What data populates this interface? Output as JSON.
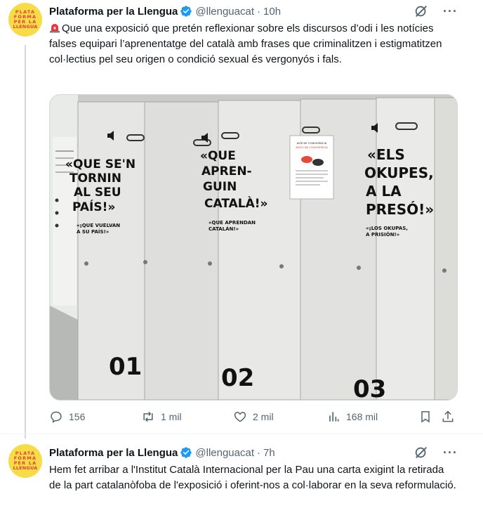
{
  "tweets": [
    {
      "avatar_lines": [
        "PLATA",
        "FORMA",
        "PER LA",
        "LLENGUA"
      ],
      "name": "Plataforma per la Llengua",
      "handle": "@llenguacat",
      "separator": "·",
      "time": "10h",
      "text": "Que una exposició que pretén reflexionar sobre els discursos d’odi i les notícies falses equipari l’aprenentatge del català amb frases que criminalitzen i estigmatitzen col·lectius pel seu origen o condició sexual és vergonyós i fals.",
      "media": {
        "lockers": [
          {
            "quote_lines": [
              "«QUE SE'N",
              "TORNIN",
              "AL SEU",
              "PAÍS!»"
            ],
            "translation_lines": [
              "«¡QUE VUELVAN",
              "A SU PAÍS!»"
            ],
            "number": "01"
          },
          {
            "quote_lines": [
              "«QUE",
              "APREN-",
              "GUIN",
              "CATALÀ!»"
            ],
            "translation_lines": [
              "«QUE APRENDAN",
              "CATALÁN!»"
            ],
            "number": "02"
          },
          {
            "quote_lines": [
              "«ELS",
              "OKUPES,",
              "A LA",
              "PRESÓ!»"
            ],
            "translation_lines": [
              "«¡LOS OKUPAS,",
              "A PRISIÓN!»"
            ],
            "number": "03"
          }
        ],
        "notice": {
          "title_lines": [
            "AVÍS DE CONVIVÈNCIA",
            "AVISO DE CONVIVENCIA"
          ]
        }
      },
      "actions": {
        "replies": "156",
        "reposts": "1 mil",
        "likes": "2 mil",
        "views": "168 mil"
      }
    },
    {
      "avatar_lines": [
        "PLATA",
        "FORMA",
        "PER LA",
        "LLENGUA"
      ],
      "name": "Plataforma per la Llengua",
      "handle": "@llenguacat",
      "separator": "·",
      "time": "7h",
      "text": "Hem fet arribar a l'Institut Català Internacional per la Pau una carta exigint la retirada de la part catalanòfoba de l'exposició i oferint-nos a col·laborar en la seva reformulació."
    }
  ],
  "icons": {
    "verified": "verified-badge-icon",
    "grok": "grok-icon",
    "more": "more-icon",
    "siren": "siren-emoji-icon",
    "reply": "reply-icon",
    "repost": "repost-icon",
    "like": "like-icon",
    "views": "views-icon",
    "bookmark": "bookmark-icon",
    "share": "share-icon"
  },
  "colors": {
    "verified": "#1d9bf0",
    "text": "#0f1419",
    "secondary": "#536471",
    "avatar_bg": "#f7dc47",
    "avatar_text": "#e0403a"
  }
}
